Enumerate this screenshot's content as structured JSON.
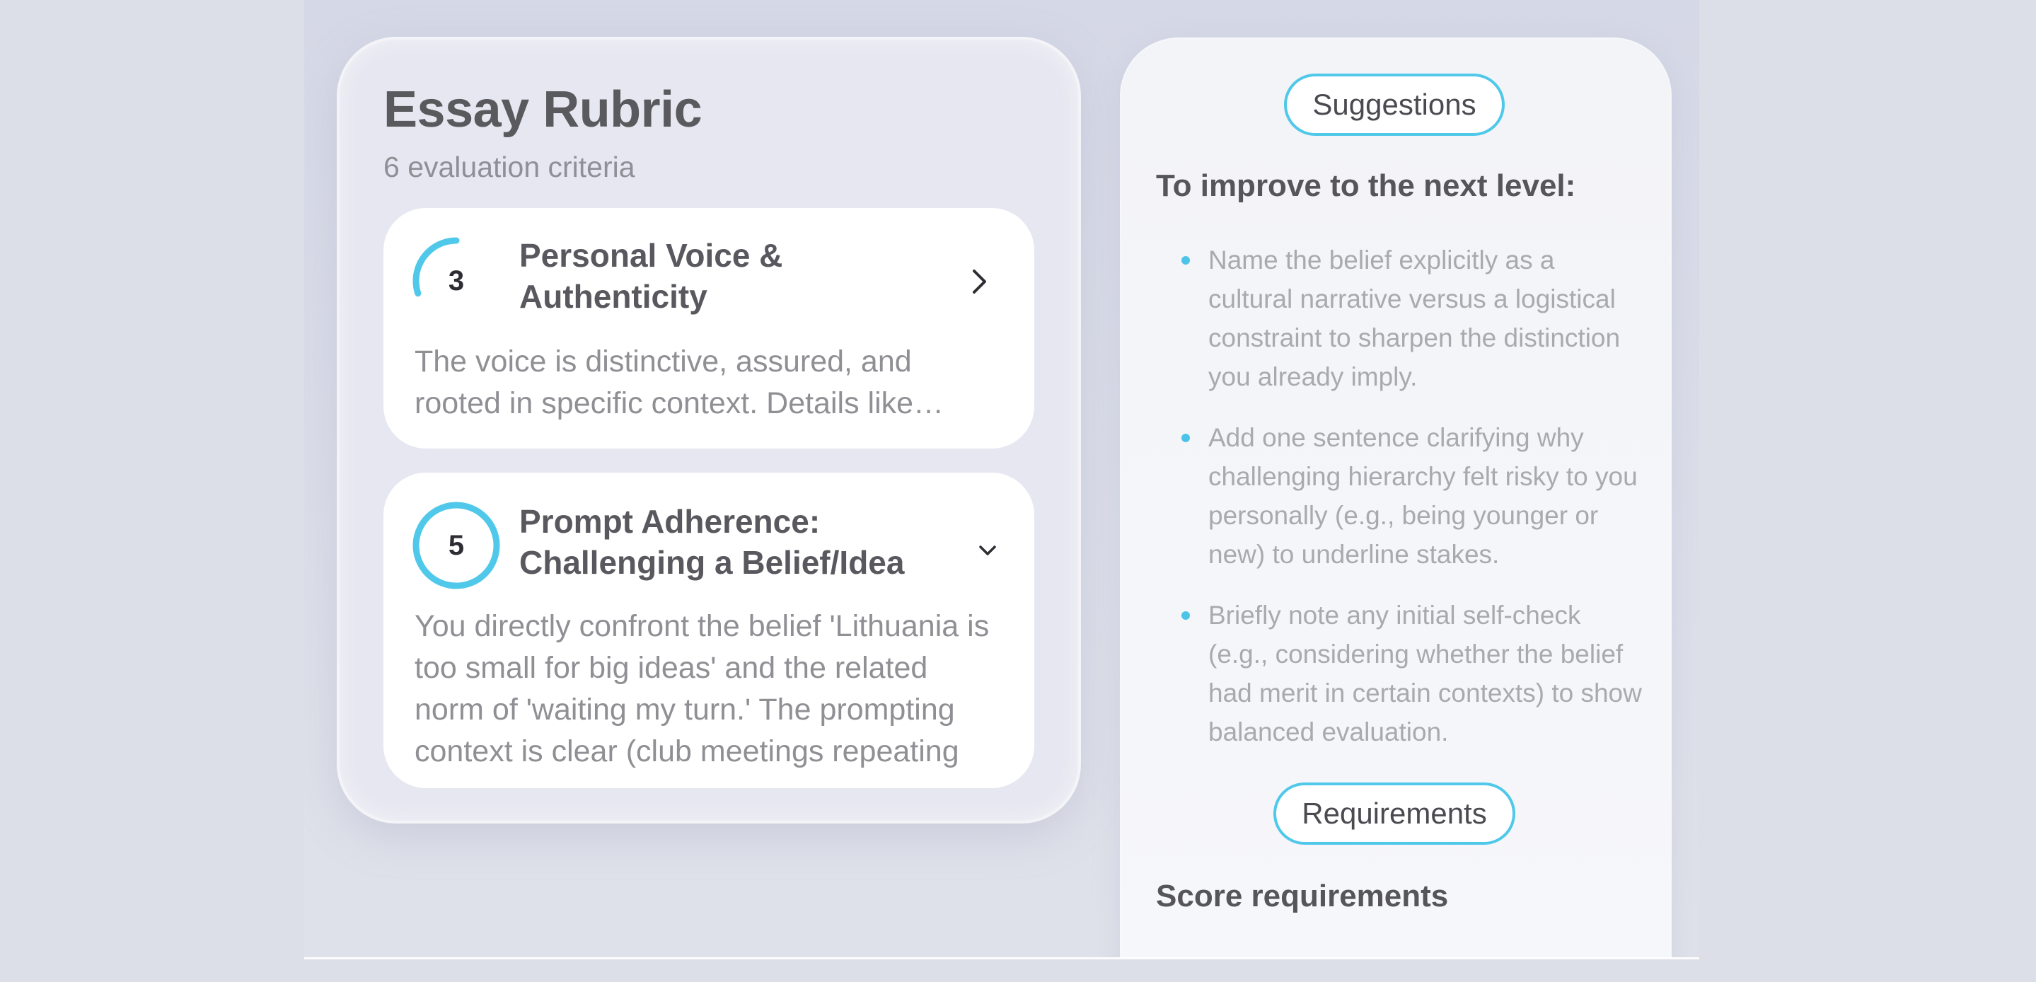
{
  "rubric": {
    "title": "Essay Rubric",
    "subtitle": "6 evaluation criteria",
    "criteria": [
      {
        "score": "3",
        "score_fraction": 0.3,
        "title": "Personal Voice & Authenticity",
        "description": "The voice is distinctive, assured, and rooted in specific context. Details like…",
        "expanded": false,
        "chevron_icon": "chevron-right-icon"
      },
      {
        "score": "5",
        "score_fraction": 1.0,
        "title": "Prompt Adherence: Challenging a Belief/Idea",
        "description": "You directly confront the belief 'Lithuania is too small for big ideas' and the related norm of 'waiting my turn.' The prompting context is clear (club meetings repeating",
        "expanded": true,
        "chevron_icon": "chevron-down-icon"
      }
    ]
  },
  "suggestions_panel": {
    "tab_suggestions": "Suggestions",
    "improve_heading": "To improve to the next level:",
    "items": [
      "Name the belief explicitly as a cultural narrative versus a logistical constraint to sharpen the distinction you already imply.",
      "Add one sentence clarifying why challenging hierarchy felt risky to you personally (e.g., being younger or new) to underline stakes.",
      "Briefly note any initial self-check (e.g., considering whether the belief had merit in certain contexts) to show balanced evaluation."
    ],
    "tab_requirements": "Requirements",
    "score_heading": "Score requirements"
  },
  "colors": {
    "accent": "#50c8ea",
    "ring_track": "#ffffff",
    "heading": "#58585e",
    "muted": "#8f8f94"
  }
}
